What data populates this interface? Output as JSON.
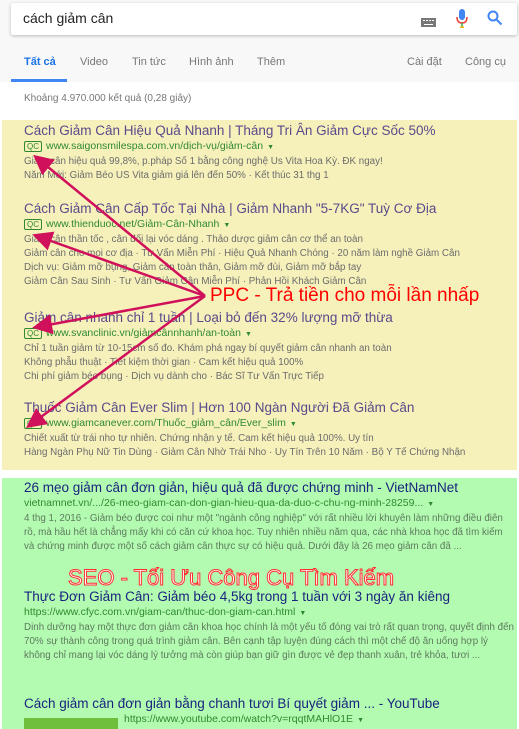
{
  "search": {
    "query": "cách giảm cân",
    "icons": [
      "keyboard-icon",
      "mic-icon",
      "search-icon"
    ]
  },
  "tabs": [
    {
      "label": "Tất cả",
      "active": true
    },
    {
      "label": "Video"
    },
    {
      "label": "Tin tức"
    },
    {
      "label": "Hình ảnh"
    },
    {
      "label": "Thêm"
    },
    {
      "label": "Cài đặt"
    },
    {
      "label": "Công cụ"
    }
  ],
  "stats": "Khoảng 4.970.000 kết quả (0,28 giây)",
  "ad_badge": "QC",
  "ads": [
    {
      "title": "Cách Giảm Cân Hiệu Quả Nhanh | Tháng Tri Ân Giảm Cực Sốc 50%",
      "url": "www.saigonsmilespa.com.vn/dịch-vụ/giảm-cân",
      "lines": [
        "Giảm cân hiệu quả 99,8%, p.pháp Số 1 bằng công nghệ Us Vita Hoa Kỳ. ĐK ngay!",
        "Năm Mới: Giảm Béo US Vita giảm giá lên đến 50% · Kết thúc 31 thg 1"
      ]
    },
    {
      "title": "Cách Giảm Cân Cấp Tốc Tại Nhà | Giảm Nhanh \"5-7KG\" Tuỳ Cơ Địa",
      "url": "www.thienduoc.net/Giảm-Cân-Nhanh",
      "lines": [
        "Giảm cân thần tốc , cân đối lại vóc dáng . Thảo dược giảm cân cơ thể an toàn",
        "Giảm cân cho mọi cơ địa · Tư Vấn Miễn Phí · Hiệu Quả Nhanh Chóng · 20 năm làm nghề Giảm Cân",
        "Dịch vụ: Giảm mỡ bụng, Giảm cân toàn thân, Giảm mỡ đùi, Giảm mỡ bắp tay",
        "Giảm Cân Sau Sinh · Tư Vấn Giảm Cân Miễn Phí · Phản Hồi Khách Giảm Cân"
      ]
    },
    {
      "title": "Giảm cân nhanh chỉ 1 tuần | Loại bỏ đến 32% lượng mỡ thừa",
      "url": "www.svanclinic.vn/giảmcânnhanh/an-toàn",
      "lines": [
        "Chỉ 1 tuần giảm từ 10-15cm số đo. Khám phá ngay bí quyết giảm cân nhanh an toàn",
        "Không phẫu thuật · Tiết kiệm thời gian · Cam kết hiệu quả 100%",
        "Chi phí giảm béo bụng · Dịch vụ dành cho · Bác Sĩ Tư Vấn Trực Tiếp"
      ]
    },
    {
      "title": "Thuốc Giảm Cân Ever Slim | Hơn 100 Ngàn Người Đã Giảm Cân",
      "url": "www.giamcanever.com/Thuốc_giảm_cân/Ever_slim",
      "lines": [
        "Chiết xuất từ trái nho tự nhiên. Chứng nhận y tế. Cam kết hiệu quả 100%. Uy tín",
        "Hàng Ngàn Phụ Nữ Tin Dùng · Giảm Cân Nhờ Trái Nho · Uy Tín Trên 10 Năm · Bộ Y Tế Chứng Nhận"
      ]
    }
  ],
  "ppc_label": "PPC - Trả tiền cho mỗi lần nhấp",
  "seo_label": "SEO - Tối Ưu Công Cụ Tìm Kiếm",
  "organic": [
    {
      "title": "26 mẹo giảm cân đơn giản, hiệu quả đã được chứng minh - VietNamNet",
      "url": "vietnamnet.vn/.../26-meo-giam-can-don-gian-hieu-qua-da-duo-c-chu-ng-minh-28259...",
      "desc": "4 thg 1, 2016 - Giảm béo được coi như một \"ngành công nghiệp\" với rất nhiều lời khuyên làm những điều điên rồ, mà hầu hết là chẳng mấy khi có căn cứ khoa học. Tuy nhiên nhiều năm qua, các nhà khoa học đã tìm kiếm và chứng minh được một số cách giảm cân thực sự có hiệu quả. Dưới đây là 26 mẹo giảm cân đã ..."
    },
    {
      "title": "Thực Đơn Giảm Cân: Giảm béo 4,5kg trong 1 tuần với 3 ngày ăn kiêng",
      "url": "https://www.cfyc.com.vn/giam-can/thuc-don-giam-can.html",
      "desc": "Dinh dưỡng hay một thực đơn giảm cân khoa học chính là một yếu tố đóng vai trò rất quan trọng, quyết định đến 70% sự thành công trong quá trình giảm cân. Bên cạnh tập luyện đúng cách thì một chế độ ăn uống hợp lý không chỉ mang lại vóc dáng lý tưởng mà còn giúp bạn giữ gìn được vẻ đẹp thanh xuân, trẻ khỏa, tươi ..."
    },
    {
      "title": "Cách giảm cân đơn giản bằng chanh tươi Bí quyết giảm ... - YouTube",
      "url": "https://www.youtube.com/watch?v=rqqtMAHlO1E"
    }
  ],
  "colors": {
    "ppc_bg": "#f6f1bb",
    "seo_bg": "#b3fbb1",
    "arrow": "#d0105a",
    "label_red": "#ff0000"
  }
}
